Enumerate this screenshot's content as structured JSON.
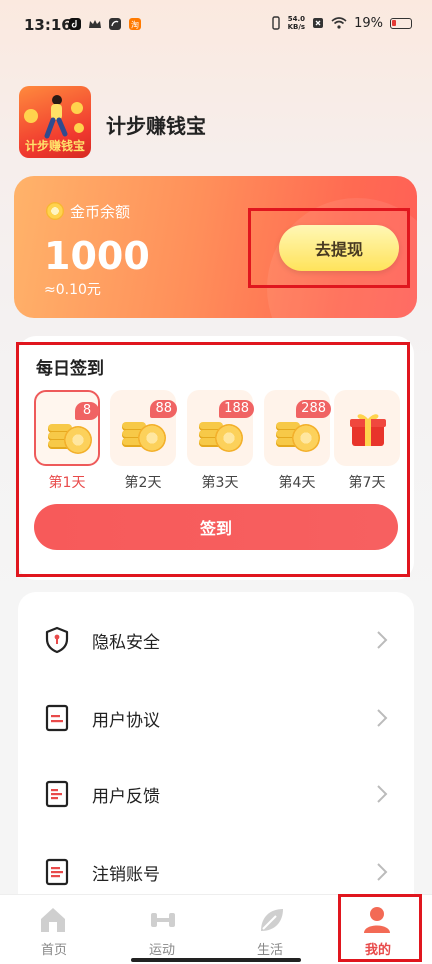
{
  "status_bar": {
    "time": "13:16",
    "net_speed_top": "54.0",
    "net_speed_unit": "KB/s",
    "battery": "19%"
  },
  "app": {
    "name": "计步赚钱宝",
    "logo_text": "计步赚钱宝"
  },
  "balance": {
    "label": "金币余额",
    "value": "1000",
    "sub": "≈0.10元",
    "withdraw_label": "去提现"
  },
  "signin": {
    "title": "每日签到",
    "days": [
      {
        "label": "第1天",
        "reward": "8",
        "active": true
      },
      {
        "label": "第2天",
        "reward": "88"
      },
      {
        "label": "第3天",
        "reward": "188"
      },
      {
        "label": "第4天",
        "reward": "288"
      },
      {
        "label": "第7天",
        "reward": "",
        "gift": true
      }
    ],
    "button_label": "签到"
  },
  "menu": [
    {
      "label": "隐私安全",
      "icon": "shield-icon"
    },
    {
      "label": "用户协议",
      "icon": "document-icon"
    },
    {
      "label": "用户反馈",
      "icon": "feedback-icon"
    },
    {
      "label": "注销账号",
      "icon": "cancel-account-icon"
    }
  ],
  "nav": [
    {
      "label": "首页",
      "icon": "home-icon"
    },
    {
      "label": "运动",
      "icon": "dumbbell-icon"
    },
    {
      "label": "生活",
      "icon": "leaf-icon"
    },
    {
      "label": "我的",
      "icon": "user-icon",
      "active": true
    }
  ],
  "colors": {
    "accent": "#f75a5a",
    "highlight_box": "#e0161e",
    "button_yellow": "#ffe14d"
  }
}
